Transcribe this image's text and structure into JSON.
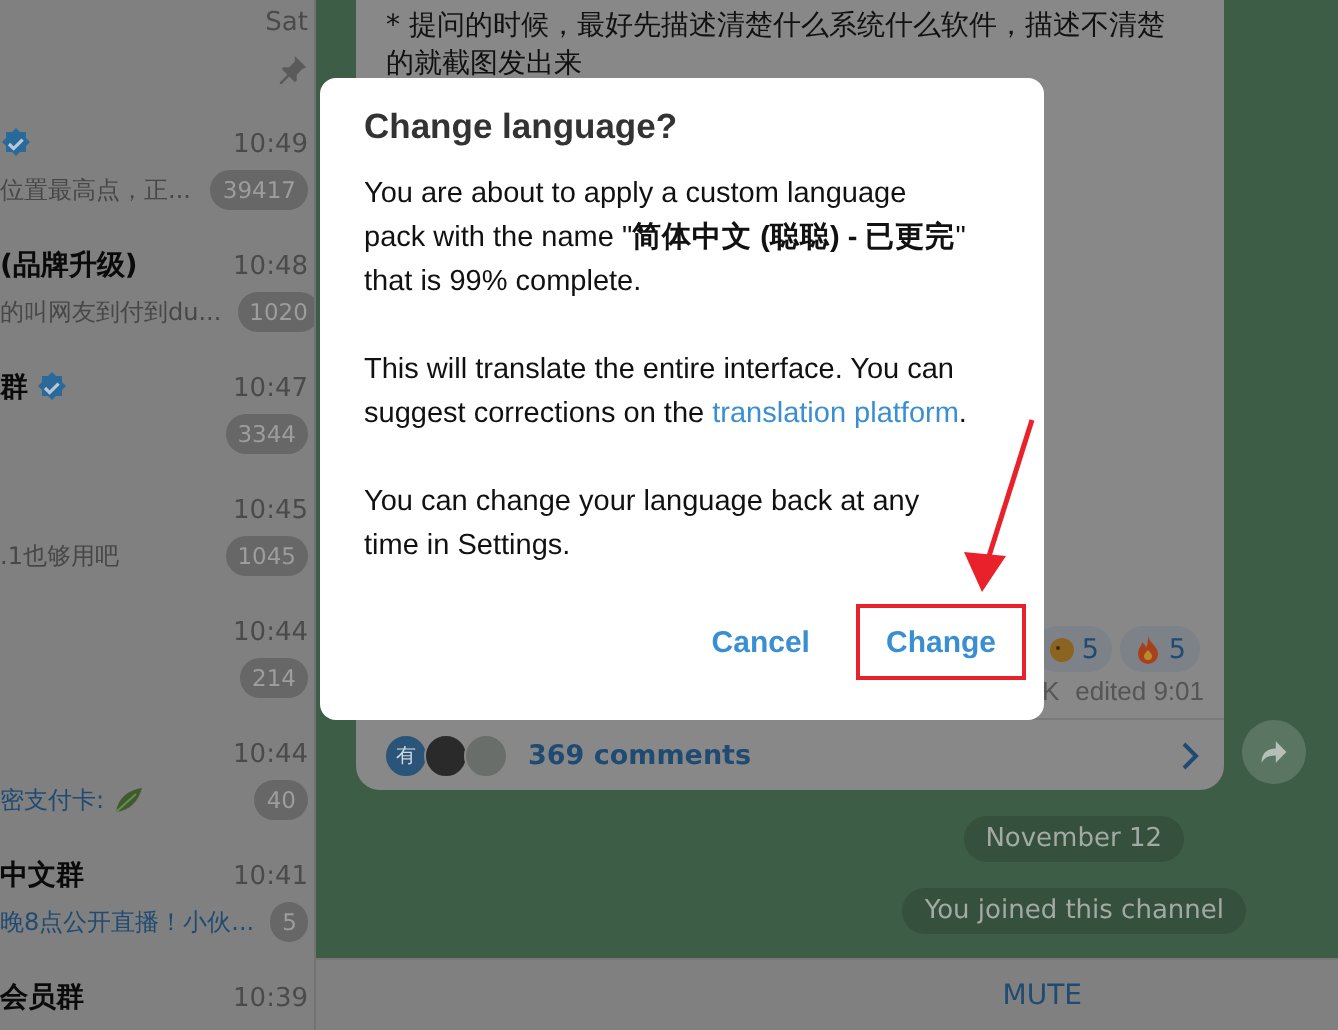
{
  "chat_list": {
    "rows": [
      {
        "time": "Sat",
        "pinned": true,
        "verified": false,
        "leaf": false
      },
      {
        "verified": true,
        "time": "10:49",
        "preview": "位置最高点，正...",
        "badge": "39417",
        "pinned": false,
        "accent": false,
        "leaf": false
      },
      {
        "name": "(品牌升级)",
        "verified": false,
        "time": "10:48",
        "preview": "的叫网友到付到du...",
        "badge": "1020",
        "pinned": false,
        "accent": false,
        "leaf": false
      },
      {
        "name": "群",
        "verified": true,
        "time": "10:47",
        "badge": "3344",
        "pinned": false,
        "leaf": false
      },
      {
        "verified": false,
        "time": "10:45",
        "preview": ".1也够用吧",
        "badge": "1045",
        "pinned": false,
        "accent": false,
        "leaf": false
      },
      {
        "verified": false,
        "time": "10:44",
        "badge": "214",
        "pinned": false,
        "leaf": false
      },
      {
        "verified": false,
        "time": "10:44",
        "preview": "密支付卡: ",
        "badge": "40",
        "pinned": false,
        "accent": true,
        "leaf": true
      },
      {
        "name": "中文群",
        "verified": false,
        "time": "10:41",
        "preview": "晚8点公开直播！小伙...",
        "badge": "5",
        "pinned": false,
        "accent": true,
        "leaf": false
      },
      {
        "name": "会员群",
        "verified": false,
        "time": "10:39",
        "pinned": false,
        "leaf": false
      }
    ]
  },
  "chat": {
    "post": {
      "text": "* 提问的时候，最好先描述清楚什么系统什么软件，描述不清楚的就截图发出来",
      "reactions": [
        {
          "kind": "emoji",
          "count": "5"
        },
        {
          "kind": "fire",
          "count": "5"
        }
      ],
      "views": "K",
      "edited": "edited 9:01",
      "comments": {
        "avatars": [
          {
            "kind": "letter",
            "initial": "有"
          },
          {
            "kind": "photo"
          },
          {
            "kind": "photo"
          }
        ],
        "label": "369 comments"
      }
    },
    "service_messages": [
      "November 12",
      "You joined this channel"
    ],
    "bottom_button": "MUTE"
  },
  "dialog": {
    "title": "Change language?",
    "paragraphs": [
      {
        "text": "You are about to apply a custom language pack with the name \"**简体中文 (聪聪) - 已更完**\" that is 99% complete."
      },
      {
        "text": "This will translate the entire interface. You can suggest corrections on the",
        "link": "translation platform",
        "after": "."
      },
      {
        "text": "You can change your language back at any time in Settings."
      }
    ],
    "buttons": [
      {
        "label": "Cancel",
        "highlighted": false
      },
      {
        "label": "Change",
        "highlighted": true
      }
    ]
  }
}
